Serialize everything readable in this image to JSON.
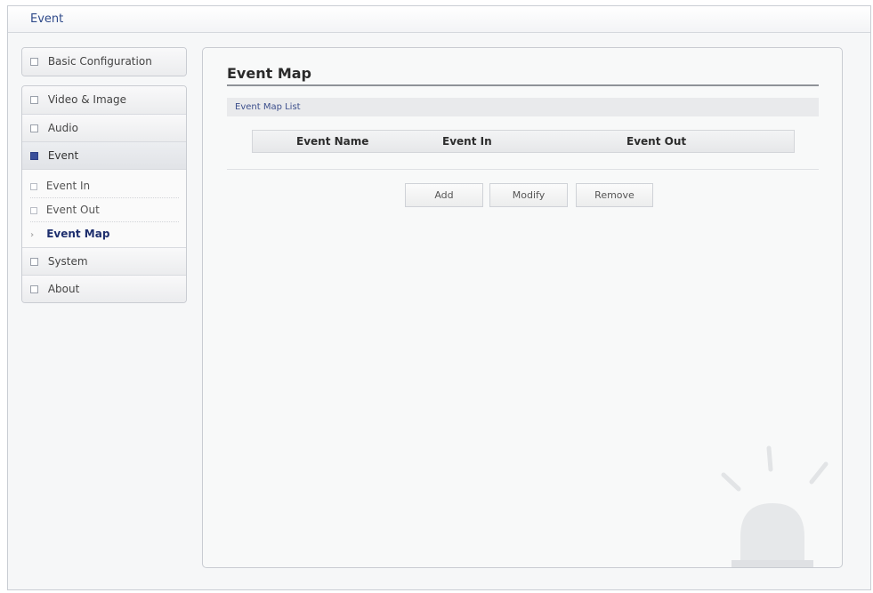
{
  "window": {
    "title": "Event"
  },
  "sidebar": {
    "top_item": "Basic Configuration",
    "items": [
      {
        "label": "Video & Image"
      },
      {
        "label": "Audio"
      },
      {
        "label": "Event"
      },
      {
        "label": "System"
      },
      {
        "label": "About"
      }
    ],
    "event_subitems": [
      {
        "label": "Event In"
      },
      {
        "label": "Event Out"
      },
      {
        "label": "Event Map"
      }
    ]
  },
  "main": {
    "title": "Event Map",
    "section_label": "Event Map List",
    "table_headers": [
      "Event Name",
      "Event In",
      "Event Out"
    ],
    "buttons": {
      "add": "Add",
      "modify": "Modify",
      "remove": "Remove"
    }
  }
}
